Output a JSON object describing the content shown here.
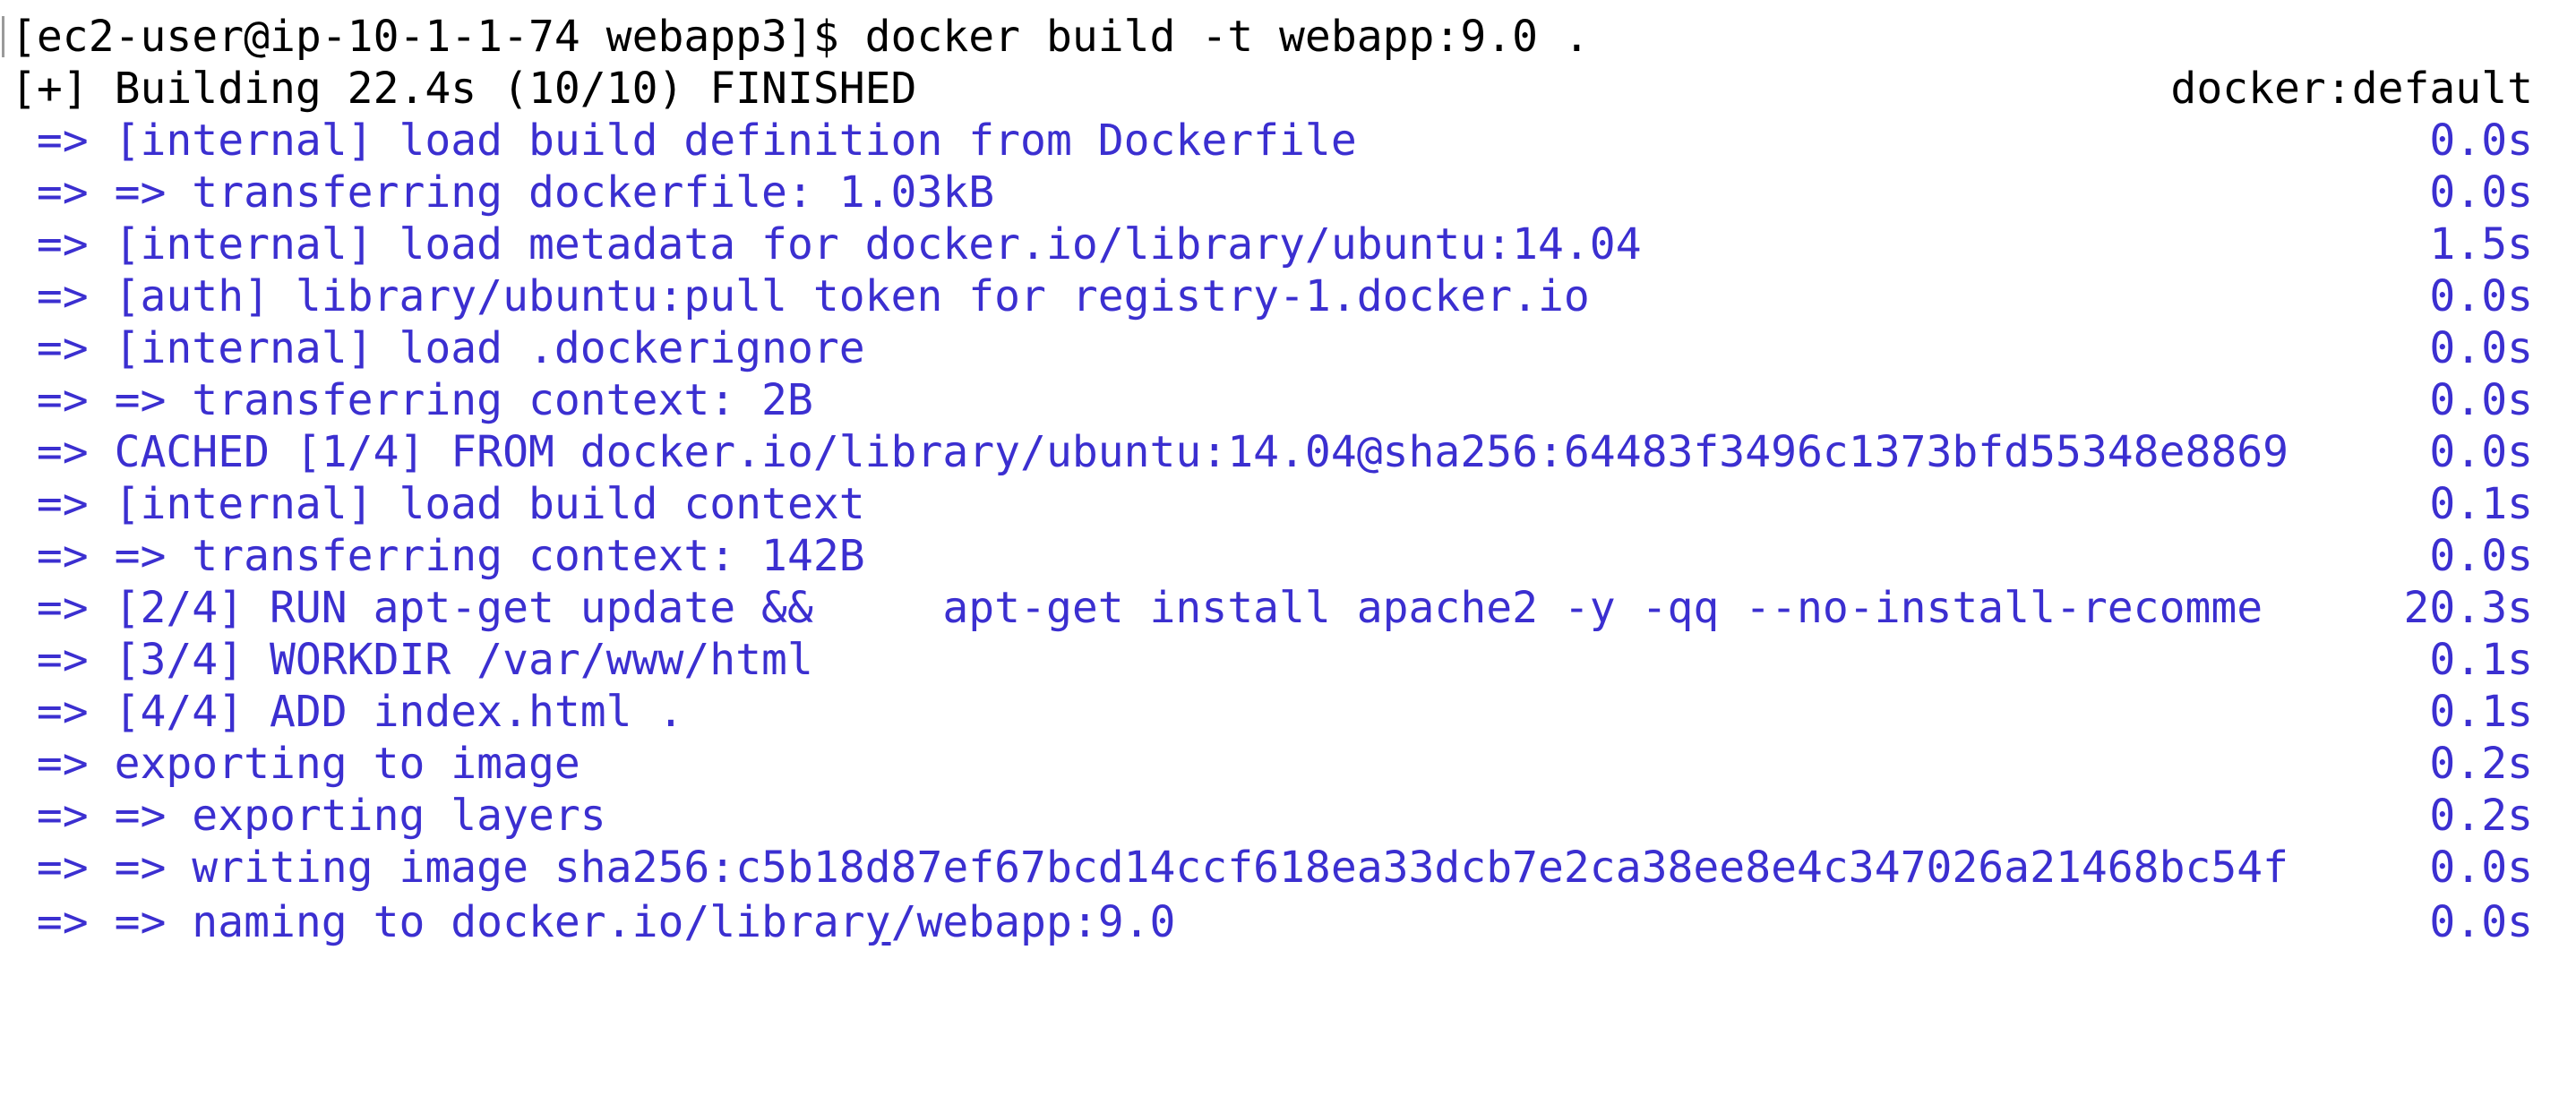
{
  "terminal": {
    "prompt_line": "[ec2-user@ip-10-1-1-74 webapp3]$ docker build -t webapp:9.0 .",
    "header": {
      "left": "[+] Building 22.4s (10/10) FINISHED",
      "right": "docker:default"
    },
    "steps": [
      {
        "text": " => [internal] load build definition from Dockerfile",
        "time": "0.0s"
      },
      {
        "text": " => => transferring dockerfile: 1.03kB",
        "time": "0.0s"
      },
      {
        "text": " => [internal] load metadata for docker.io/library/ubuntu:14.04",
        "time": "1.5s"
      },
      {
        "text": " => [auth] library/ubuntu:pull token for registry-1.docker.io",
        "time": "0.0s"
      },
      {
        "text": " => [internal] load .dockerignore",
        "time": "0.0s"
      },
      {
        "text": " => => transferring context: 2B",
        "time": "0.0s"
      },
      {
        "text": " => CACHED [1/4] FROM docker.io/library/ubuntu:14.04@sha256:64483f3496c1373bfd55348e8869",
        "time": "0.0s"
      },
      {
        "text": " => [internal] load build context",
        "time": "0.1s"
      },
      {
        "text": " => => transferring context: 142B",
        "time": "0.0s"
      },
      {
        "text": " => [2/4] RUN apt-get update &&     apt-get install apache2 -y -qq --no-install-recomme",
        "time": "20.3s"
      },
      {
        "text": " => [3/4] WORKDIR /var/www/html",
        "time": "0.1s"
      },
      {
        "text": " => [4/4] ADD index.html .",
        "time": "0.1s"
      },
      {
        "text": " => exporting to image",
        "time": "0.2s"
      },
      {
        "text": " => => exporting layers",
        "time": "0.2s"
      },
      {
        "text": " => => writing image sha256:c5b18d87ef67bcd14ccf618ea33dcb7e2ca38ee8e4c347026a21468bc54f",
        "time": "0.0s"
      }
    ],
    "last_step": {
      "prefix": " => => naming to docker.io/librar",
      "underlined": "y",
      "suffix": "/webapp:9.0",
      "time": "0.0s"
    },
    "colors": {
      "background": "#ffffff",
      "prompt_text": "#000000",
      "step_text": "#3b2fd0"
    }
  }
}
